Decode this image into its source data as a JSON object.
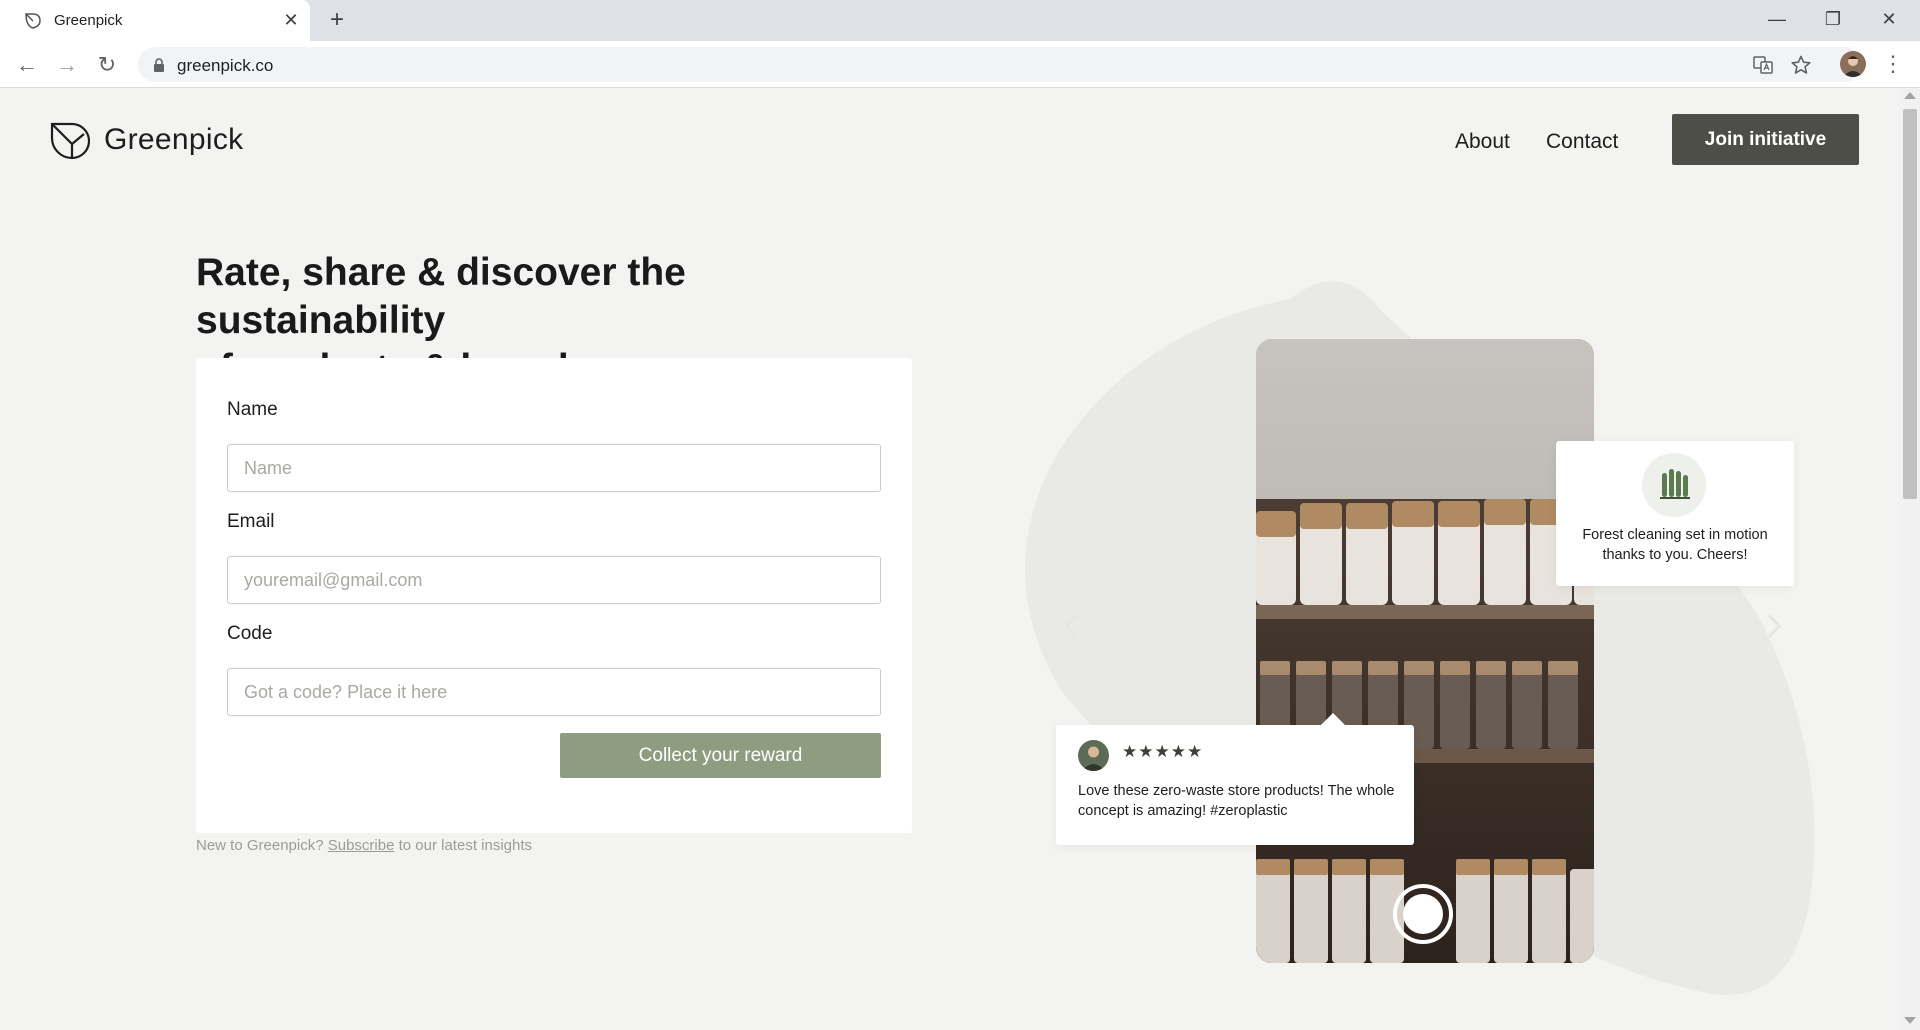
{
  "browser": {
    "tab_title": "Greenpick",
    "tab_close": "✕",
    "new_tab": "+",
    "url": "greenpick.co",
    "window_controls": {
      "minimize": "—",
      "maximize": "❐",
      "close": "✕"
    },
    "nav": {
      "back": "←",
      "forward": "→",
      "reload": "↻",
      "menu": "⋮"
    }
  },
  "header": {
    "brand": "Greenpick",
    "nav_links": [
      "About",
      "Contact"
    ],
    "cta": "Join initiative"
  },
  "hero": {
    "title_line1": "Rate, share & discover the sustainability",
    "title_line2": "of products & brands"
  },
  "form": {
    "name_label": "Name",
    "name_placeholder": "Name",
    "email_label": "Email",
    "email_placeholder": "youremail@gmail.com",
    "code_label": "Code",
    "code_placeholder": "Got a code? Place it here",
    "submit": "Collect your reward"
  },
  "footnote": {
    "prefix": "New to Greenpick?",
    "link": "Subscribe",
    "suffix": "to our latest insights"
  },
  "showcase": {
    "notification": "Forest cleaning set in motion thanks to you. Cheers!",
    "review_stars": "★★★★★",
    "review_text": "Love these zero-waste store products! The whole concept is amazing! #zeroplastic"
  },
  "colors": {
    "page_bg": "#f3f4f1",
    "cta_bg": "#4c4e47",
    "reward_btn": "#8e9d80"
  }
}
